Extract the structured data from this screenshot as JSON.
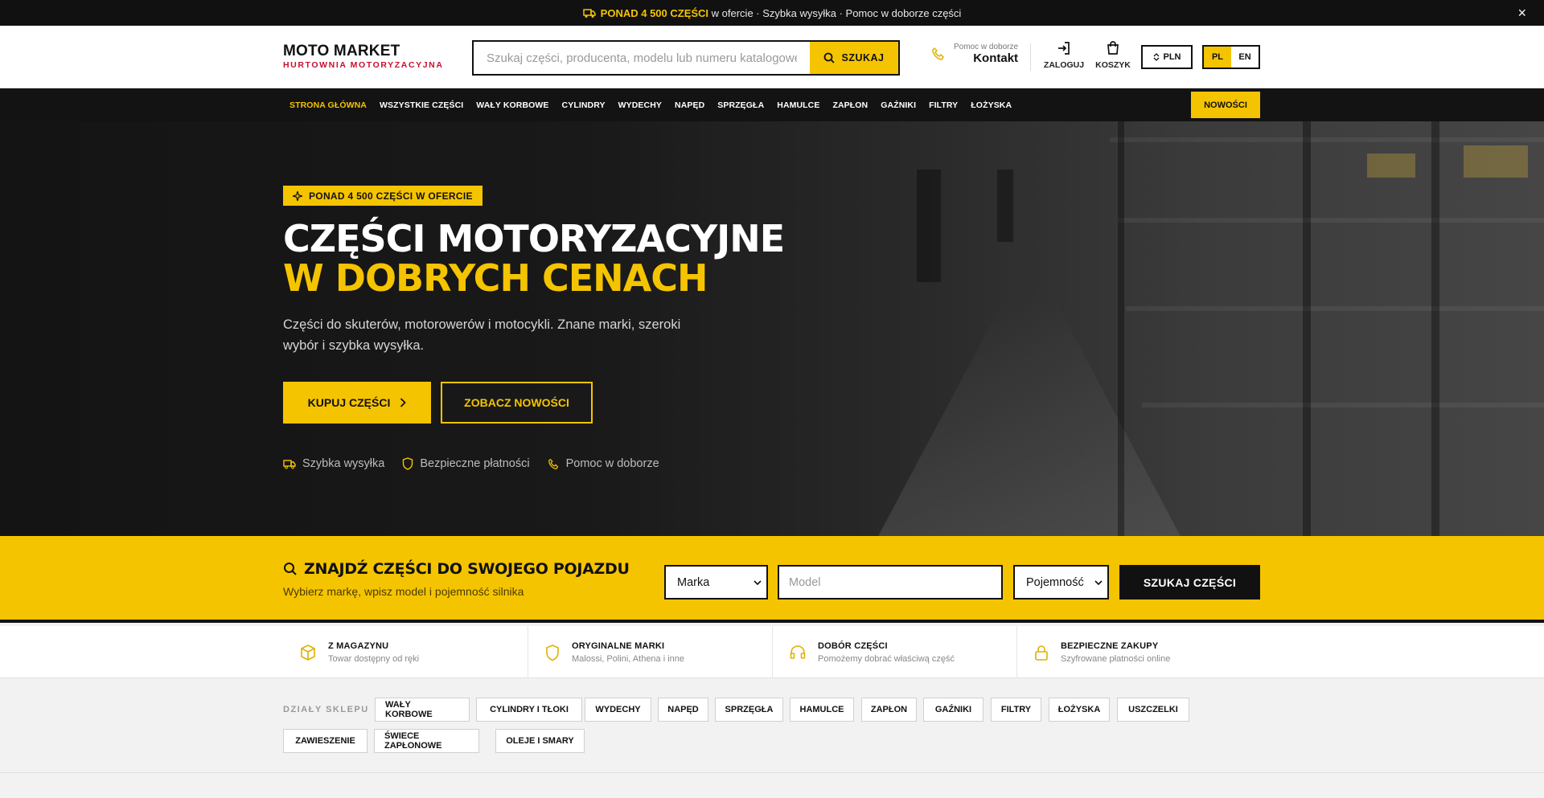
{
  "topbar": {
    "highlight": "PONAD 4 500 CZĘŚCI",
    "text": " w ofercie · Szybka wysyłka · Pomoc w doborze części",
    "close": "×"
  },
  "header": {
    "logo_name": "MOTO MARKET",
    "logo_sub": "HURTOWNIA MOTORYZACYJNA",
    "search_placeholder": "Szukaj części, producenta, modelu lub numeru katalogowego...",
    "search_button": "SZUKAJ",
    "contact_small": "Pomoc w doborze",
    "contact_big": "Kontakt",
    "login": "ZALOGUJ",
    "cart": "KOSZYK",
    "currency": "PLN",
    "lang_pl": "PL",
    "lang_en": "EN"
  },
  "nav": {
    "items": [
      "STRONA GŁÓWNA",
      "WSZYSTKIE CZĘŚCI",
      "WAŁY KORBOWE",
      "CYLINDRY",
      "WYDECHY",
      "NAPĘD",
      "SPRZĘGŁA",
      "HAMULCE",
      "ZAPŁON",
      "GAŹNIKI",
      "FILTRY",
      "ŁOŻYSKA"
    ],
    "news": "NOWOŚCI"
  },
  "hero": {
    "badge": "PONAD 4 500 CZĘŚCI W OFERCIE",
    "title_line1": "CZĘŚCI MOTORYZACYJNE",
    "title_line2": "W DOBRYCH CENACH",
    "lead": "Części do skuterów, motorowerów i motocykli. Znane marki, szeroki wybór i szybka wysyłka.",
    "cta_primary": "KUPUJ CZĘŚCI",
    "cta_secondary": "ZOBACZ NOWOŚCI",
    "trust": [
      "Szybka wysyłka",
      "Bezpieczne płatności",
      "Pomoc w doborze"
    ]
  },
  "finder": {
    "title": "ZNAJDŹ CZĘŚCI DO SWOJEGO POJAZDU",
    "subtitle": "Wybierz markę, wpisz model i pojemność silnika",
    "brand": "Marka",
    "model_placeholder": "Model",
    "capacity": "Pojemność",
    "button": "SZUKAJ CZĘŚCI"
  },
  "features": [
    {
      "title": "Z MAGAZYNU",
      "desc": "Towar dostępny od ręki",
      "icon": "box-icon"
    },
    {
      "title": "ORYGINALNE MARKI",
      "desc": "Malossi, Polini, Athena i inne",
      "icon": "shield-icon"
    },
    {
      "title": "DOBÓR CZĘŚCI",
      "desc": "Pomożemy dobrać właściwą część",
      "icon": "headset-icon"
    },
    {
      "title": "BEZPIECZNE ZAKUPY",
      "desc": "Szyfrowane płatności online",
      "icon": "lock-icon"
    }
  ],
  "sections": {
    "label": "DZIAŁY SKLEPU",
    "chips": [
      "WAŁY KORBOWE",
      "CYLINDRY I TŁOKI",
      "WYDECHY",
      "NAPĘD",
      "SPRZĘGŁA",
      "HAMULCE",
      "ZAPŁON",
      "GAŹNIKI",
      "FILTRY",
      "ŁOŻYSKA",
      "USZCZELKI",
      "ZAWIESZENIE",
      "ŚWIECE ZAPŁONOWE",
      "OLEJE I SMARY"
    ]
  },
  "colors": {
    "accent": "#f5c400",
    "dark": "#111111",
    "brand_red": "#c8102e"
  }
}
